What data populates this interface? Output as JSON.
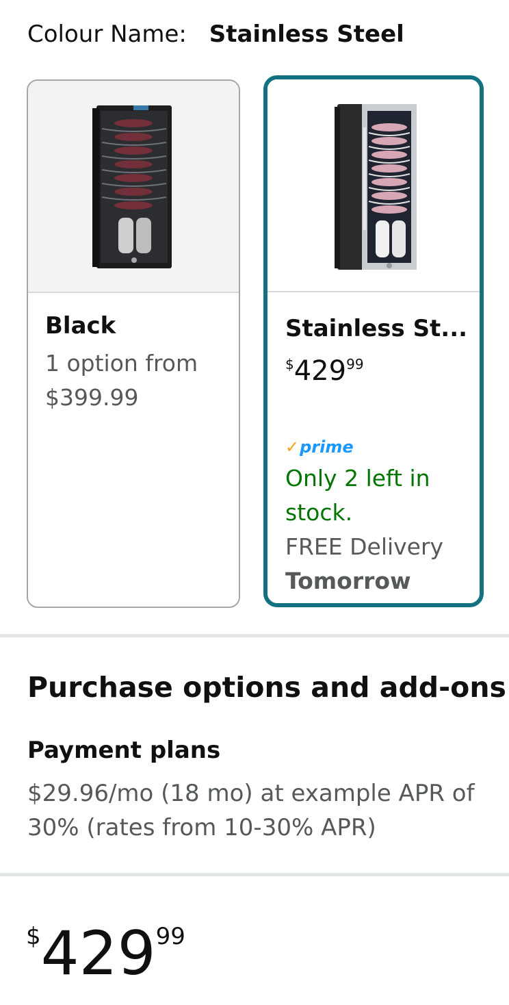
{
  "colour": {
    "label": "Colour Name:",
    "value": "Stainless Steel"
  },
  "options": [
    {
      "name": "Black",
      "line1": "1 option from",
      "line2": "$399.99"
    },
    {
      "name": "Stainless St...",
      "price": {
        "currency": "$",
        "whole": "429",
        "fraction": "99"
      },
      "prime": "prime",
      "stock": "Only 2 left in stock.",
      "delivery": "FREE Delivery",
      "delivery_day": "Tomorrow"
    }
  ],
  "purchase": {
    "title": "Purchase options and add-ons",
    "plans_title": "Payment plans",
    "plans_text": "$29.96/mo (18 mo) at example APR of 30% (rates from 10-30% APR)"
  },
  "main_price": {
    "currency": "$",
    "whole": "429",
    "fraction": "99"
  },
  "colors": {
    "accent": "#127281",
    "stock": "#007600",
    "prime": "#1a98ff"
  }
}
